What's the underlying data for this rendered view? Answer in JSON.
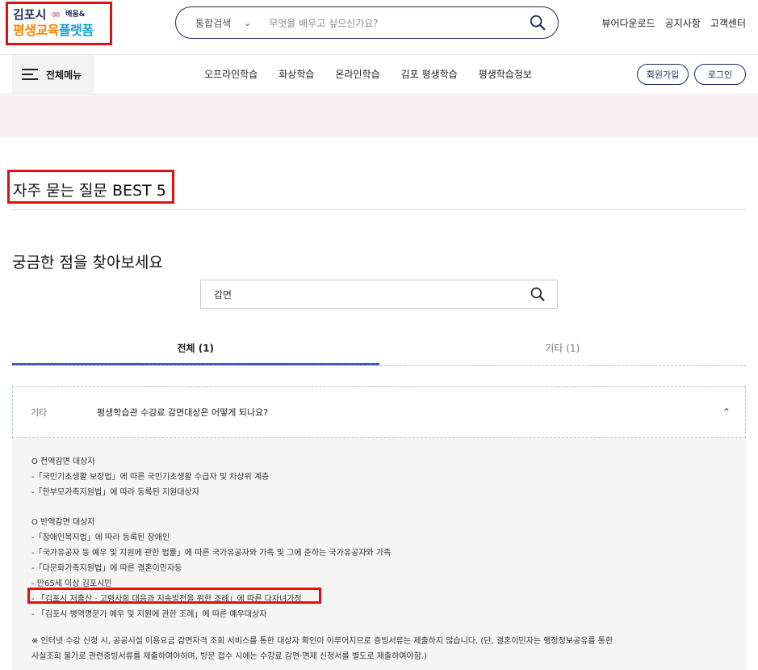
{
  "header": {
    "logo_line1": "김포시",
    "logo_sub": "배움&",
    "logo_line2a": "평생교육",
    "logo_line2b": "플랫폼",
    "search_category": "통합검색",
    "search_placeholder": "무엇을 배우고 싶으신가요?",
    "links": [
      "뷰어다운로드",
      "공지사항",
      "고객센터"
    ]
  },
  "nav": {
    "all_menu": "전체메뉴",
    "items": [
      "오프라인학습",
      "화상학습",
      "온라인학습",
      "김포 평생학습",
      "평생학습정보"
    ],
    "join": "회원가입",
    "login": "로그인"
  },
  "page": {
    "title": "자주 묻는 질문 BEST 5",
    "subtitle": "궁금한 점을 찾아보세요",
    "faq_search_value": "감면"
  },
  "tabs": [
    {
      "label": "전체 (1)"
    },
    {
      "label": "기타 (1)"
    }
  ],
  "faq": {
    "category": "기타",
    "question": "평생학습관 수강료 감면대상은 어떻게 되나요?",
    "answer_group1_title": "O 전액감면 대상자",
    "answer_group1": [
      "-「국민기초생활 보장법」에 따른 국민기초생활 수급자 및 차상위 계층",
      "-「한부모가족지원법」에 따라 등록된 지원대상자"
    ],
    "answer_group2_title": "O 반액감면 대상자",
    "answer_group2": [
      "-「장애인복지법」에 따라 등록된 장애인",
      "-「국가유공자 등 예우 및 지원에 관한 법률」에 따른 국가유공자와 가족 및 그에 준하는 국가유공자와 가족",
      "-「다문화가족지원법」에 따른 결혼이민자등",
      "- 만65세 이상 김포시민",
      "- 「김포시 저출산 · 고령사회 대응과 지속발전을 위한 조례」에 따른 다자녀가정",
      "- 「김포시 병역명문가 예우 및 지원에 관한 조례」에 따른 예우대상자"
    ],
    "note_line1": "※ 인터넷 수강 신청 시, 공공시설 이용요금 감면자격 조회 서비스를 통한 대상자 확인이 이루어지므로 증빙서류는 제출하지 않습니다.  (단, 결혼이민자는 행정정보공유를 통한",
    "note_line2": "사실조회 불가로 관련증빙서류를 제출하여야하며, 방문 접수 시에는 수강료 감면·면제 신청서를 별도로 제출하여야함.)"
  },
  "colors": {
    "highlight_red": "#e01010",
    "brand_navy": "#1a2a5c",
    "tab_accent": "#3d5cc0",
    "banner_pink": "#fbeef2"
  }
}
